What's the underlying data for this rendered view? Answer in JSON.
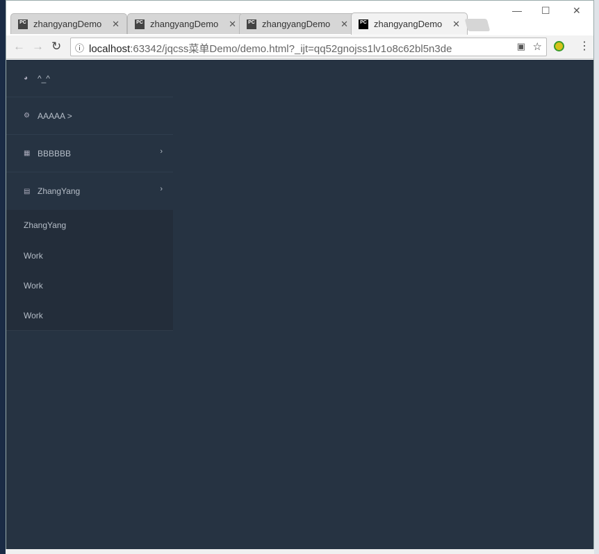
{
  "browser": {
    "tabs": [
      {
        "title": "zhangyangDemo"
      },
      {
        "title": "zhangyangDemo"
      },
      {
        "title": "zhangyangDemo"
      },
      {
        "title": "zhangyangDemo",
        "active": true
      }
    ],
    "favicon_text": "PC",
    "url_host": "localhost",
    "url_rest": ":63342/jqcss菜单Demo/demo.html?_ijt=qq52gnojss1lv1o8c62bl5n3de"
  },
  "menu": {
    "items": [
      {
        "label": "^_^",
        "icon": "dashboard-icon"
      },
      {
        "label": "AAAAA >",
        "icon": "cogs-icon"
      },
      {
        "label": "BBBBBB",
        "icon": "table-icon",
        "chevron": true
      },
      {
        "label": "ZhangYang",
        "icon": "list-icon",
        "chevron": true,
        "expanded": true
      }
    ],
    "submenu": [
      "ZhangYang",
      "Work",
      "Work",
      "Work"
    ]
  },
  "colors": {
    "page_bg": "#263342",
    "submenu_bg": "#232d3a"
  }
}
